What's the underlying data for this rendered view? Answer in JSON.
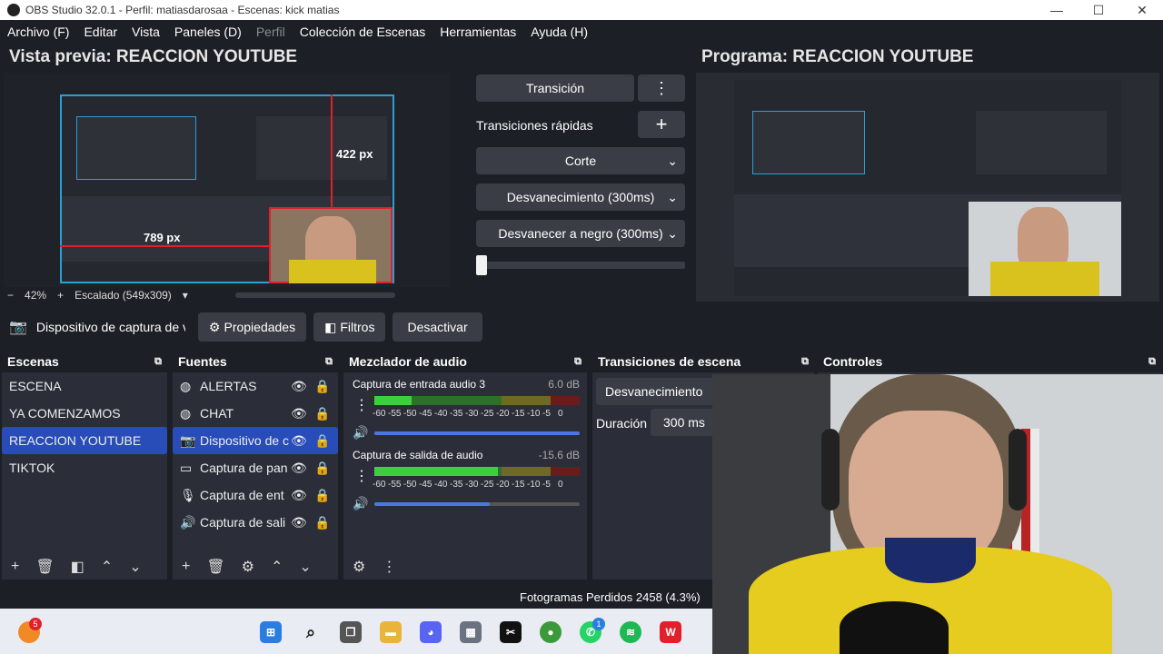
{
  "titlebar": {
    "title": "OBS Studio 32.0.1 - Perfil: matiasdarosaa - Escenas: kick matias"
  },
  "menu": {
    "items": [
      {
        "label": "Archivo (F)"
      },
      {
        "label": "Editar"
      },
      {
        "label": "Vista"
      },
      {
        "label": "Paneles (D)"
      },
      {
        "label": "Perfil",
        "disabled": true
      },
      {
        "label": "Colección de Escenas"
      },
      {
        "label": "Herramientas"
      },
      {
        "label": "Ayuda (H)"
      }
    ]
  },
  "preview": {
    "title": "Vista previa: REACCION YOUTUBE",
    "size_label_h": "789 px",
    "size_label_v": "422 px",
    "zoom": "42%",
    "scale_label": "Escalado (549x309)"
  },
  "program": {
    "title": "Programa: REACCION YOUTUBE"
  },
  "transitions_panel": {
    "transition_button": "Transición",
    "quick_label": "Transiciones rápidas",
    "quick_items": [
      "Corte",
      "Desvanecimiento (300ms)",
      "Desvanecer a negro (300ms)"
    ],
    "tbar_level": 0.0
  },
  "source_toolbar": {
    "source_name": "Dispositivo de captura de v",
    "properties": "Propiedades",
    "filters": "Filtros",
    "deactivate": "Desactivar"
  },
  "scenes": {
    "title": "Escenas",
    "items": [
      "ESCENA",
      "YA COMENZAMOS",
      "REACCION YOUTUBE",
      "TIKTOK"
    ],
    "selected_index": 2
  },
  "sources": {
    "title": "Fuentes",
    "items": [
      {
        "label": "ALERTAS",
        "icon": "browser-icon"
      },
      {
        "label": "CHAT",
        "icon": "browser-icon"
      },
      {
        "label": "Dispositivo de c",
        "icon": "camera-icon"
      },
      {
        "label": "Captura de pan",
        "icon": "monitor-icon"
      },
      {
        "label": "Captura de ent",
        "icon": "microphone-icon"
      },
      {
        "label": "Captura de sali",
        "icon": "speaker-icon"
      }
    ],
    "selected_index": 2
  },
  "mixer": {
    "title": "Mezclador de audio",
    "channels": [
      {
        "name": "Captura de entrada audio 3",
        "db": "6.0 dB",
        "volume": 1.0,
        "peak": 0.18
      },
      {
        "name": "Captura de salida de audio",
        "db": "-15.6 dB",
        "volume": 0.56,
        "peak": 0.6
      }
    ],
    "scale": [
      "-60",
      "-55",
      "-50",
      "-45",
      "-40",
      "-35",
      "-30",
      "-25",
      "-20",
      "-15",
      "-10",
      "-5",
      "0"
    ]
  },
  "scene_transitions": {
    "title": "Transiciones de escena",
    "selected": "Desvanecimiento",
    "duration_label": "Duración",
    "duration_value": "300 ms"
  },
  "controls": {
    "title": "Controles"
  },
  "status": {
    "dropped_frames": "Fotogramas Perdidos 2458 (4.3%)"
  },
  "taskbar": {
    "notification_badge": "5",
    "whatsapp_badge": "1"
  },
  "colors": {
    "accent": "#284cb8",
    "selection_red": "#e0202a",
    "meter_green": "#3ecf3e",
    "meter_yellow": "#c8c23a",
    "meter_red": "#a42424"
  }
}
